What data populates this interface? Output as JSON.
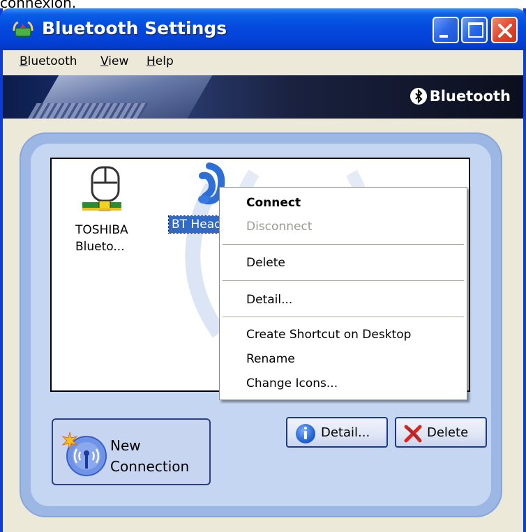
{
  "caption_top": "connexion.",
  "window": {
    "title": "Bluetooth Settings",
    "brand": "Bluetooth"
  },
  "menu": [
    "Bluetooth",
    "View",
    "Help"
  ],
  "devices": [
    {
      "label": "TOSHIBA\nBlueto...",
      "icon": "bluetooth-stack-icon",
      "selected": false
    },
    {
      "label": "BT Headset",
      "icon": "headset-icon",
      "selected": true
    }
  ],
  "context_menu": {
    "items": [
      {
        "label": "Connect",
        "bold": true,
        "enabled": true
      },
      {
        "label": "Disconnect",
        "bold": false,
        "enabled": false
      },
      {
        "label": "Delete",
        "bold": false,
        "enabled": true
      },
      {
        "label": "Detail...",
        "bold": false,
        "enabled": true
      },
      {
        "label": "Create Shortcut on Desktop",
        "bold": false,
        "enabled": true
      },
      {
        "label": "Rename",
        "bold": false,
        "enabled": true
      },
      {
        "label": "Change Icons...",
        "bold": false,
        "enabled": true
      }
    ]
  },
  "buttons": {
    "new_connection": "New\nConnection",
    "detail": "Detail...",
    "delete": "Delete"
  },
  "colors": {
    "title_blue": "#0449dd",
    "panel_blue": "#9db7e4",
    "selection": "#316ac5"
  }
}
